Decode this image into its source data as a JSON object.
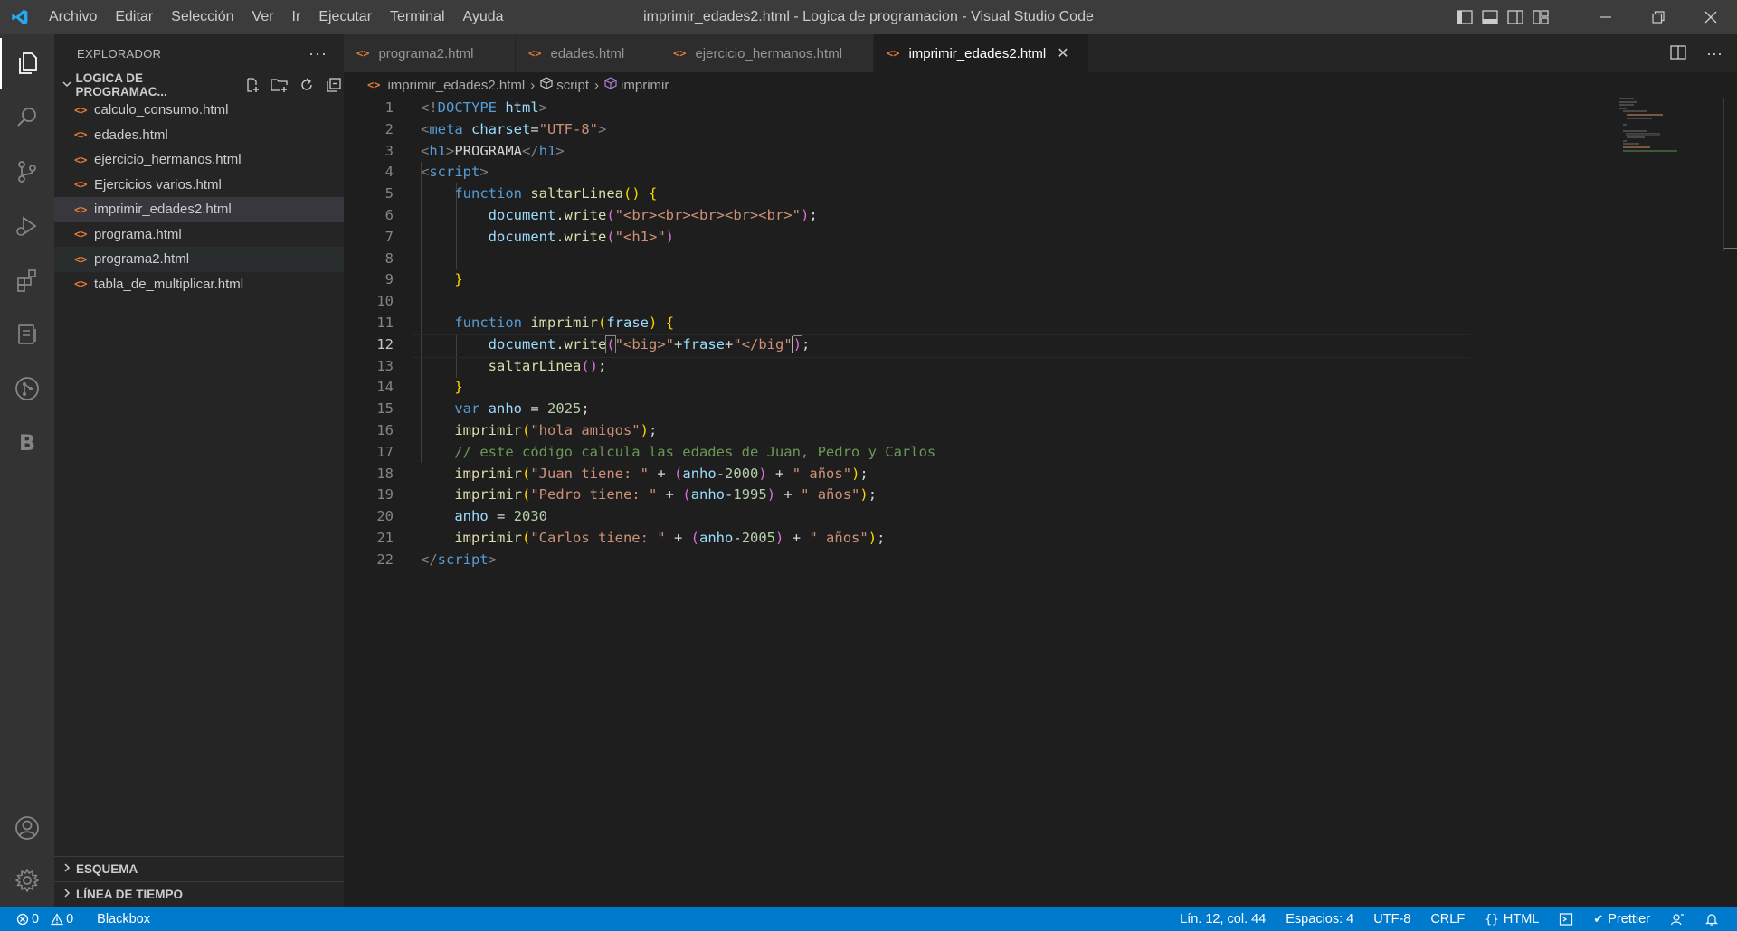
{
  "titlebar": {
    "menu": [
      "Archivo",
      "Editar",
      "Selección",
      "Ver",
      "Ir",
      "Ejecutar",
      "Terminal",
      "Ayuda"
    ],
    "window_title": "imprimir_edades2.html - Logica de programacion - Visual Studio Code"
  },
  "activitybar": {
    "items": [
      "explorer-icon",
      "search-icon",
      "source-control-icon",
      "run-debug-icon",
      "extensions-icon",
      "remote-explorer-icon",
      "git-graph-icon",
      "blackbox-icon"
    ],
    "blackbox_letter": "B",
    "bottom": [
      "account-icon",
      "settings-gear-icon"
    ]
  },
  "sidebar": {
    "header": "EXPLORADOR",
    "more": "···",
    "folder_name": "LOGICA DE PROGRAMAC...",
    "file_icon": "<>",
    "files": [
      "calculo_consumo.html",
      "edades.html",
      "ejercicio_hermanos.html",
      "Ejercicios varios.html",
      "imprimir_edades2.html",
      "programa.html",
      "programa2.html",
      "tabla_de_multiplicar.html"
    ],
    "selected_file": "imprimir_edades2.html",
    "sections": [
      "ESQUEMA",
      "LÍNEA DE TIEMPO"
    ]
  },
  "tabs": [
    {
      "label": "programa2.html",
      "active": false
    },
    {
      "label": "edades.html",
      "active": false
    },
    {
      "label": "ejercicio_hermanos.html",
      "active": false
    },
    {
      "label": "imprimir_edades2.html",
      "active": true
    }
  ],
  "tab_close": "✕",
  "breadcrumb": {
    "file": "imprimir_edades2.html",
    "symbol1": "script",
    "symbol2": "imprimir"
  },
  "editor": {
    "current_line": 12,
    "line_count": 22
  },
  "statusbar": {
    "errors": "0",
    "warnings": "0",
    "blackbox": "Blackbox",
    "position": "Lín. 12, col. 44",
    "spaces": "Espacios: 4",
    "encoding": "UTF-8",
    "eol": "CRLF",
    "language": "HTML",
    "formatter": "Prettier"
  },
  "colors": {
    "accent": "#007acc",
    "html_icon": "#e37933"
  }
}
